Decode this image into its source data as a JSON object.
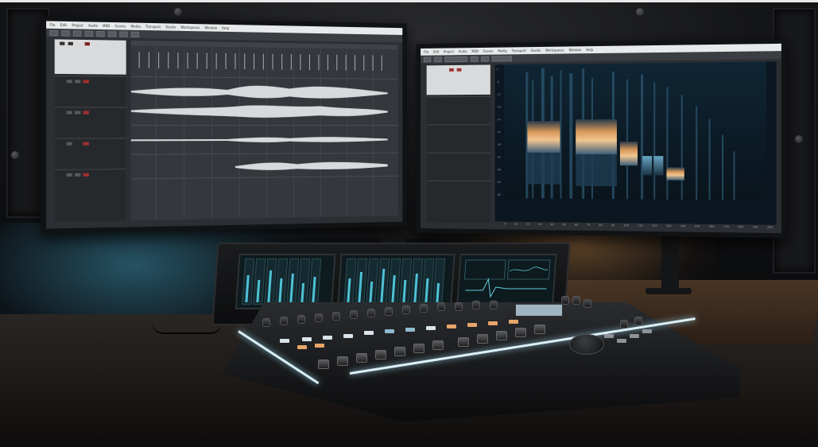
{
  "left_monitor": {
    "menu_items": [
      "File",
      "Edit",
      "Project",
      "Audio",
      "MIDI",
      "Scores",
      "Media",
      "Transport",
      "Studio",
      "Workspaces",
      "Window",
      "Help"
    ]
  },
  "right_monitor": {
    "menu_items": [
      "File",
      "Edit",
      "Project",
      "Audio",
      "MIDI",
      "Scores",
      "Media",
      "Transport",
      "Studio",
      "Workspaces",
      "Window",
      "Help"
    ],
    "spectrum_y_ticks": [
      "0",
      "-6",
      "-12",
      "-18",
      "-24",
      "-30",
      "-36",
      "-42",
      "-48",
      "-54",
      "-60"
    ],
    "spectrum_x_ticks": [
      "0",
      "10",
      "20",
      "30",
      "40",
      "50",
      "60",
      "70",
      "80",
      "90",
      "100",
      "110",
      "120",
      "130",
      "140",
      "150",
      "160",
      "170",
      "180",
      "190",
      "200"
    ]
  },
  "colors": {
    "daw_background": "#2b2f33",
    "waveform": "#d7dadd",
    "spectrum_band_orange": "#d89a5a",
    "spectrum_band_blue": "#5b93b3",
    "console_lcd_accent": "#4ec1d6",
    "ambient_blue": "#3c8caa",
    "ambient_warm": "#be8246"
  }
}
